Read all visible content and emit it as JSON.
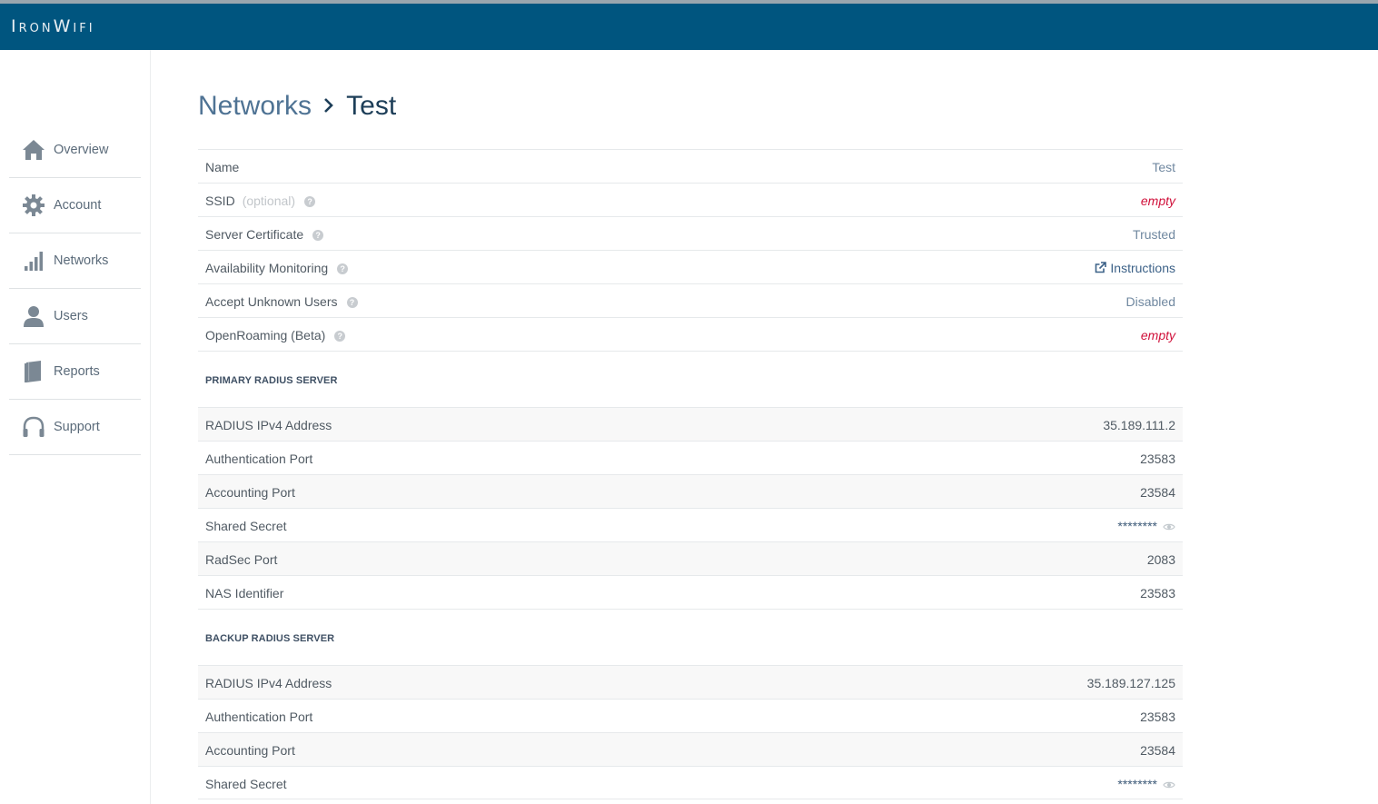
{
  "app": {
    "logo": "IronWifi"
  },
  "sidebar": {
    "items": [
      {
        "label": "Overview",
        "icon": "home-icon"
      },
      {
        "label": "Account",
        "icon": "gear-icon"
      },
      {
        "label": "Networks",
        "icon": "signal-bars-icon"
      },
      {
        "label": "Users",
        "icon": "user-icon"
      },
      {
        "label": "Reports",
        "icon": "book-icon"
      },
      {
        "label": "Support",
        "icon": "headphones-icon"
      }
    ]
  },
  "breadcrumb": {
    "parent": "Networks",
    "current": "Test"
  },
  "settings": {
    "name": {
      "label": "Name",
      "value": "Test"
    },
    "ssid": {
      "label": "SSID",
      "hint": "(optional)",
      "value": "empty"
    },
    "server_certificate": {
      "label": "Server Certificate",
      "value": "Trusted"
    },
    "availability_monitoring": {
      "label": "Availability Monitoring",
      "value": "Instructions"
    },
    "accept_unknown_users": {
      "label": "Accept Unknown Users",
      "value": "Disabled"
    },
    "openroaming": {
      "label": "OpenRoaming (Beta)",
      "value": "empty"
    }
  },
  "primary": {
    "title": "PRIMARY RADIUS SERVER",
    "rows": [
      {
        "label": "RADIUS IPv4 Address",
        "value": "35.189.111.2"
      },
      {
        "label": "Authentication Port",
        "value": "23583"
      },
      {
        "label": "Accounting Port",
        "value": "23584"
      },
      {
        "label": "Shared Secret",
        "value": "********"
      },
      {
        "label": "RadSec Port",
        "value": "2083"
      },
      {
        "label": "NAS Identifier",
        "value": "23583"
      }
    ]
  },
  "backup": {
    "title": "BACKUP RADIUS SERVER",
    "rows": [
      {
        "label": "RADIUS IPv4 Address",
        "value": "35.189.127.125"
      },
      {
        "label": "Authentication Port",
        "value": "23583"
      },
      {
        "label": "Accounting Port",
        "value": "23584"
      },
      {
        "label": "Shared Secret",
        "value": "********"
      }
    ]
  },
  "colors": {
    "header": "#00557f",
    "empty": "#d0103a",
    "accent": "#4f7394"
  }
}
